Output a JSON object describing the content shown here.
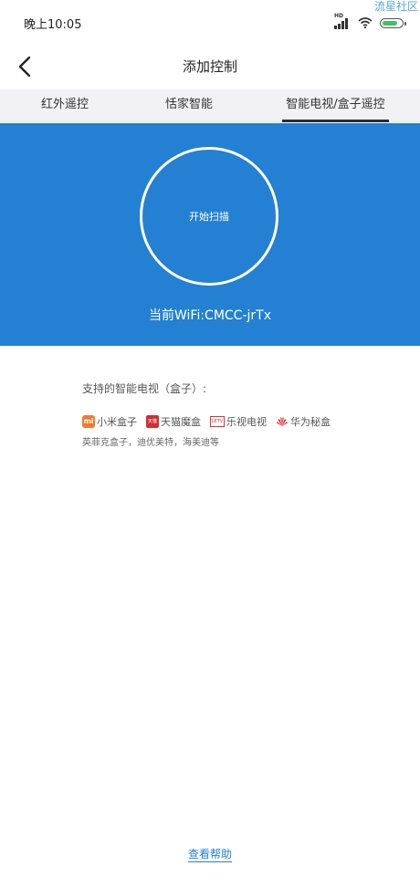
{
  "status_bar": {
    "time": "晚上10:05",
    "icons": [
      "hd-signal-icon",
      "wifi-icon",
      "battery-icon"
    ],
    "watermark": "流星社区"
  },
  "nav": {
    "back_icon": "chevron-left-icon",
    "title": "添加控制"
  },
  "tabs": [
    {
      "label": "红外遥控",
      "active": false
    },
    {
      "label": "恬家智能",
      "active": false
    },
    {
      "label": "智能电视/盒子遥控",
      "active": true
    }
  ],
  "scan": {
    "button_label": "开始扫描",
    "wifi_text": "当前WiFi:CMCC-jrTx",
    "background_color": "#2480d2"
  },
  "support": {
    "title": "支持的智能电视（盒子）:",
    "brands": [
      {
        "name": "小米盒子",
        "icon": "xiaomi-logo-icon"
      },
      {
        "name": "天猫魔盒",
        "icon": "tmall-logo-icon"
      },
      {
        "name": "乐视电视",
        "icon": "letv-logo-icon"
      },
      {
        "name": "华为秘盒",
        "icon": "huawei-logo-icon"
      }
    ],
    "others": "英菲克盒子，迪优美特，海美迪等"
  },
  "footer": {
    "help_link": "查看帮助"
  }
}
